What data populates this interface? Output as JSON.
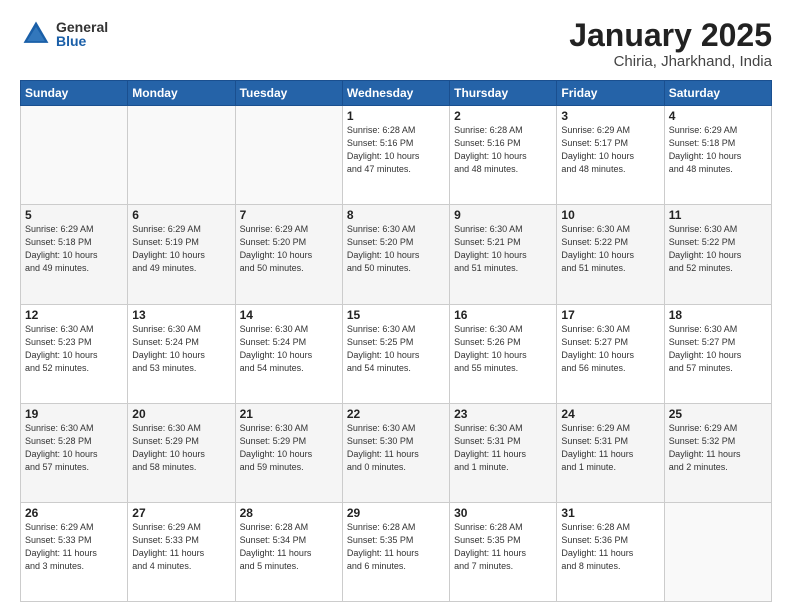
{
  "header": {
    "logo_general": "General",
    "logo_blue": "Blue",
    "title": "January 2025",
    "subtitle": "Chiria, Jharkhand, India"
  },
  "weekdays": [
    "Sunday",
    "Monday",
    "Tuesday",
    "Wednesday",
    "Thursday",
    "Friday",
    "Saturday"
  ],
  "weeks": [
    [
      {
        "day": "",
        "info": ""
      },
      {
        "day": "",
        "info": ""
      },
      {
        "day": "",
        "info": ""
      },
      {
        "day": "1",
        "info": "Sunrise: 6:28 AM\nSunset: 5:16 PM\nDaylight: 10 hours\nand 47 minutes."
      },
      {
        "day": "2",
        "info": "Sunrise: 6:28 AM\nSunset: 5:16 PM\nDaylight: 10 hours\nand 48 minutes."
      },
      {
        "day": "3",
        "info": "Sunrise: 6:29 AM\nSunset: 5:17 PM\nDaylight: 10 hours\nand 48 minutes."
      },
      {
        "day": "4",
        "info": "Sunrise: 6:29 AM\nSunset: 5:18 PM\nDaylight: 10 hours\nand 48 minutes."
      }
    ],
    [
      {
        "day": "5",
        "info": "Sunrise: 6:29 AM\nSunset: 5:18 PM\nDaylight: 10 hours\nand 49 minutes."
      },
      {
        "day": "6",
        "info": "Sunrise: 6:29 AM\nSunset: 5:19 PM\nDaylight: 10 hours\nand 49 minutes."
      },
      {
        "day": "7",
        "info": "Sunrise: 6:29 AM\nSunset: 5:20 PM\nDaylight: 10 hours\nand 50 minutes."
      },
      {
        "day": "8",
        "info": "Sunrise: 6:30 AM\nSunset: 5:20 PM\nDaylight: 10 hours\nand 50 minutes."
      },
      {
        "day": "9",
        "info": "Sunrise: 6:30 AM\nSunset: 5:21 PM\nDaylight: 10 hours\nand 51 minutes."
      },
      {
        "day": "10",
        "info": "Sunrise: 6:30 AM\nSunset: 5:22 PM\nDaylight: 10 hours\nand 51 minutes."
      },
      {
        "day": "11",
        "info": "Sunrise: 6:30 AM\nSunset: 5:22 PM\nDaylight: 10 hours\nand 52 minutes."
      }
    ],
    [
      {
        "day": "12",
        "info": "Sunrise: 6:30 AM\nSunset: 5:23 PM\nDaylight: 10 hours\nand 52 minutes."
      },
      {
        "day": "13",
        "info": "Sunrise: 6:30 AM\nSunset: 5:24 PM\nDaylight: 10 hours\nand 53 minutes."
      },
      {
        "day": "14",
        "info": "Sunrise: 6:30 AM\nSunset: 5:24 PM\nDaylight: 10 hours\nand 54 minutes."
      },
      {
        "day": "15",
        "info": "Sunrise: 6:30 AM\nSunset: 5:25 PM\nDaylight: 10 hours\nand 54 minutes."
      },
      {
        "day": "16",
        "info": "Sunrise: 6:30 AM\nSunset: 5:26 PM\nDaylight: 10 hours\nand 55 minutes."
      },
      {
        "day": "17",
        "info": "Sunrise: 6:30 AM\nSunset: 5:27 PM\nDaylight: 10 hours\nand 56 minutes."
      },
      {
        "day": "18",
        "info": "Sunrise: 6:30 AM\nSunset: 5:27 PM\nDaylight: 10 hours\nand 57 minutes."
      }
    ],
    [
      {
        "day": "19",
        "info": "Sunrise: 6:30 AM\nSunset: 5:28 PM\nDaylight: 10 hours\nand 57 minutes."
      },
      {
        "day": "20",
        "info": "Sunrise: 6:30 AM\nSunset: 5:29 PM\nDaylight: 10 hours\nand 58 minutes."
      },
      {
        "day": "21",
        "info": "Sunrise: 6:30 AM\nSunset: 5:29 PM\nDaylight: 10 hours\nand 59 minutes."
      },
      {
        "day": "22",
        "info": "Sunrise: 6:30 AM\nSunset: 5:30 PM\nDaylight: 11 hours\nand 0 minutes."
      },
      {
        "day": "23",
        "info": "Sunrise: 6:30 AM\nSunset: 5:31 PM\nDaylight: 11 hours\nand 1 minute."
      },
      {
        "day": "24",
        "info": "Sunrise: 6:29 AM\nSunset: 5:31 PM\nDaylight: 11 hours\nand 1 minute."
      },
      {
        "day": "25",
        "info": "Sunrise: 6:29 AM\nSunset: 5:32 PM\nDaylight: 11 hours\nand 2 minutes."
      }
    ],
    [
      {
        "day": "26",
        "info": "Sunrise: 6:29 AM\nSunset: 5:33 PM\nDaylight: 11 hours\nand 3 minutes."
      },
      {
        "day": "27",
        "info": "Sunrise: 6:29 AM\nSunset: 5:33 PM\nDaylight: 11 hours\nand 4 minutes."
      },
      {
        "day": "28",
        "info": "Sunrise: 6:28 AM\nSunset: 5:34 PM\nDaylight: 11 hours\nand 5 minutes."
      },
      {
        "day": "29",
        "info": "Sunrise: 6:28 AM\nSunset: 5:35 PM\nDaylight: 11 hours\nand 6 minutes."
      },
      {
        "day": "30",
        "info": "Sunrise: 6:28 AM\nSunset: 5:35 PM\nDaylight: 11 hours\nand 7 minutes."
      },
      {
        "day": "31",
        "info": "Sunrise: 6:28 AM\nSunset: 5:36 PM\nDaylight: 11 hours\nand 8 minutes."
      },
      {
        "day": "",
        "info": ""
      }
    ]
  ]
}
